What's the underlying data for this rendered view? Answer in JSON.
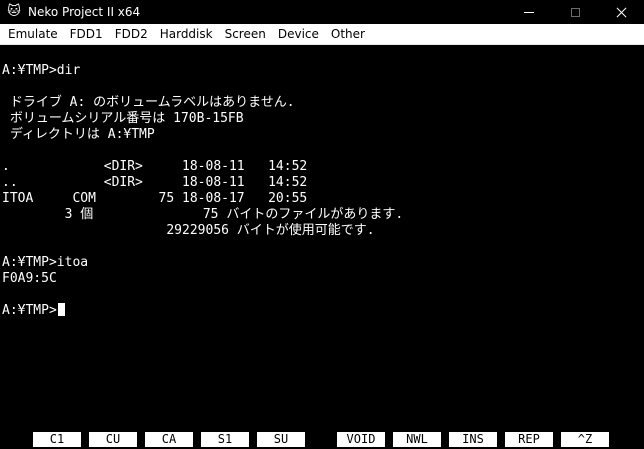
{
  "window": {
    "title": "Neko Project II x64",
    "app_icon": "cat-icon"
  },
  "menu": {
    "items": [
      "Emulate",
      "FDD1",
      "FDD2",
      "Harddisk",
      "Screen",
      "Device",
      "Other"
    ]
  },
  "terminal": {
    "lines": [
      "A:¥TMP>dir",
      "",
      " ドライブ A: のボリュームラベルはありません.",
      " ボリュームシリアル番号は 170B-15FB",
      " ディレクトリは A:¥TMP",
      "",
      ".            <DIR>     18-08-11   14:52",
      "..           <DIR>     18-08-11   14:52",
      "ITOA     COM        75 18-08-17   20:55",
      "        3 個              75 バイトのファイルがあります.",
      "                     29229056 バイトが使用可能です.",
      "",
      "A:¥TMP>itoa",
      "F0A9:5C",
      "",
      "A:¥TMP>"
    ]
  },
  "function_keys": [
    "C1",
    "CU",
    "CA",
    "S1",
    "SU",
    "VOID",
    "NWL",
    "INS",
    "REP",
    "^Z"
  ],
  "colors": {
    "background": "#000000",
    "text": "#ffffff",
    "menubar": "#ffffff"
  }
}
